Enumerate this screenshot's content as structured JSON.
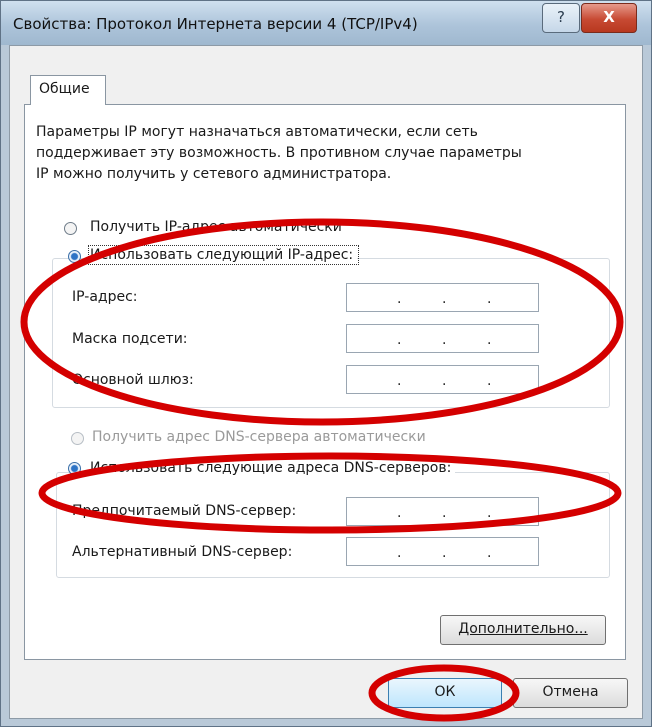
{
  "window": {
    "title": "Свойства: Протокол Интернета версии 4 (TCP/IPv4)",
    "help_glyph": "?",
    "close_glyph": "X"
  },
  "tabs": [
    {
      "label": "Общие"
    }
  ],
  "intro": {
    "line1": "Параметры IP могут назначаться автоматически, если сеть",
    "line2": "поддерживает эту возможность. В противном случае параметры",
    "line3": "IP можно получить у сетевого администратора."
  },
  "ip_mode": {
    "auto_label": "Получить IP-адрес автоматически",
    "manual_label": "Использовать следующий IP-адрес:",
    "selected": "manual"
  },
  "ip_fields": [
    {
      "label": "IP-адрес:",
      "value": ". . ."
    },
    {
      "label": "Маска подсети:",
      "value": ". . ."
    },
    {
      "label": "Основной шлюз:",
      "value": ". . ."
    }
  ],
  "dns_mode": {
    "auto_label": "Получить адрес DNS-сервера автоматически",
    "manual_label": "Использовать следующие адреса DNS-серверов:",
    "selected": "manual"
  },
  "dns_fields": [
    {
      "label": "Предпочитаемый DNS-сервер:",
      "value": ". . ."
    },
    {
      "label": "Альтернативный DNS-сервер:",
      "value": ". . ."
    }
  ],
  "buttons": {
    "advanced": "Дополнительно...",
    "ok": "ОК",
    "cancel": "Отмена"
  },
  "annotation_color": "#d40000"
}
